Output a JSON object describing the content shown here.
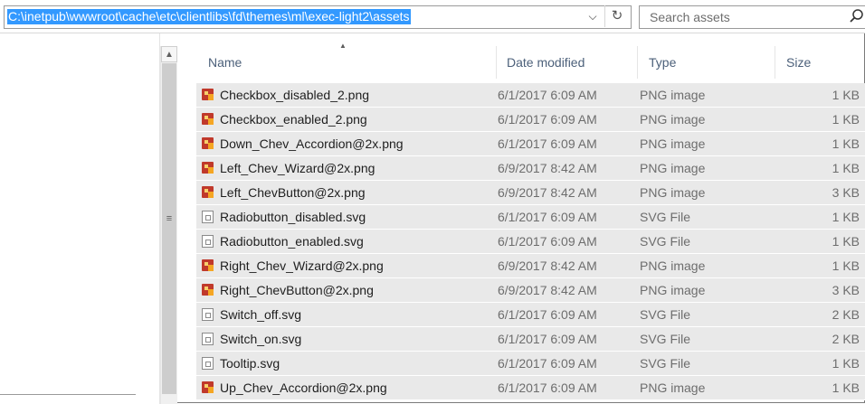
{
  "address": {
    "path": "C:\\inetpub\\wwwroot\\cache\\etc\\clientlibs\\fd\\themes\\ml\\exec-light2\\assets"
  },
  "search": {
    "placeholder": "Search assets"
  },
  "columns": {
    "name": "Name",
    "date": "Date modified",
    "type": "Type",
    "size": "Size"
  },
  "files": [
    {
      "name": "Checkbox_disabled_2.png",
      "date": "6/1/2017 6:09 AM",
      "type": "PNG image",
      "size": "1 KB",
      "icon": "png-image-icon"
    },
    {
      "name": "Checkbox_enabled_2.png",
      "date": "6/1/2017 6:09 AM",
      "type": "PNG image",
      "size": "1 KB",
      "icon": "png-image-icon"
    },
    {
      "name": "Down_Chev_Accordion@2x.png",
      "date": "6/1/2017 6:09 AM",
      "type": "PNG image",
      "size": "1 KB",
      "icon": "png-image-icon"
    },
    {
      "name": "Left_Chev_Wizard@2x.png",
      "date": "6/9/2017 8:42 AM",
      "type": "PNG image",
      "size": "1 KB",
      "icon": "png-image-icon"
    },
    {
      "name": "Left_ChevButton@2x.png",
      "date": "6/9/2017 8:42 AM",
      "type": "PNG image",
      "size": "3 KB",
      "icon": "png-image-icon"
    },
    {
      "name": "Radiobutton_disabled.svg",
      "date": "6/1/2017 6:09 AM",
      "type": "SVG File",
      "size": "1 KB",
      "icon": "svg-file-icon"
    },
    {
      "name": "Radiobutton_enabled.svg",
      "date": "6/1/2017 6:09 AM",
      "type": "SVG File",
      "size": "1 KB",
      "icon": "svg-file-icon"
    },
    {
      "name": "Right_Chev_Wizard@2x.png",
      "date": "6/9/2017 8:42 AM",
      "type": "PNG image",
      "size": "1 KB",
      "icon": "png-image-icon"
    },
    {
      "name": "Right_ChevButton@2x.png",
      "date": "6/9/2017 8:42 AM",
      "type": "PNG image",
      "size": "3 KB",
      "icon": "png-image-icon"
    },
    {
      "name": "Switch_off.svg",
      "date": "6/1/2017 6:09 AM",
      "type": "SVG File",
      "size": "2 KB",
      "icon": "svg-file-icon"
    },
    {
      "name": "Switch_on.svg",
      "date": "6/1/2017 6:09 AM",
      "type": "SVG File",
      "size": "2 KB",
      "icon": "svg-file-icon"
    },
    {
      "name": "Tooltip.svg",
      "date": "6/1/2017 6:09 AM",
      "type": "SVG File",
      "size": "1 KB",
      "icon": "svg-file-icon"
    },
    {
      "name": "Up_Chev_Accordion@2x.png",
      "date": "6/1/2017 6:09 AM",
      "type": "PNG image",
      "size": "1 KB",
      "icon": "png-image-icon"
    }
  ],
  "icons": {
    "dropdown": "chevron-down-icon",
    "refresh": "refresh-icon",
    "search": "search-icon",
    "sort": "sort-ascending-icon",
    "scroll_up": "scroll-up-arrow-icon",
    "grip": "scroll-grip-icon"
  },
  "colors": {
    "selection": "#3399ff",
    "row_selected": "#e9e9e9",
    "header_text": "#4c607a"
  }
}
